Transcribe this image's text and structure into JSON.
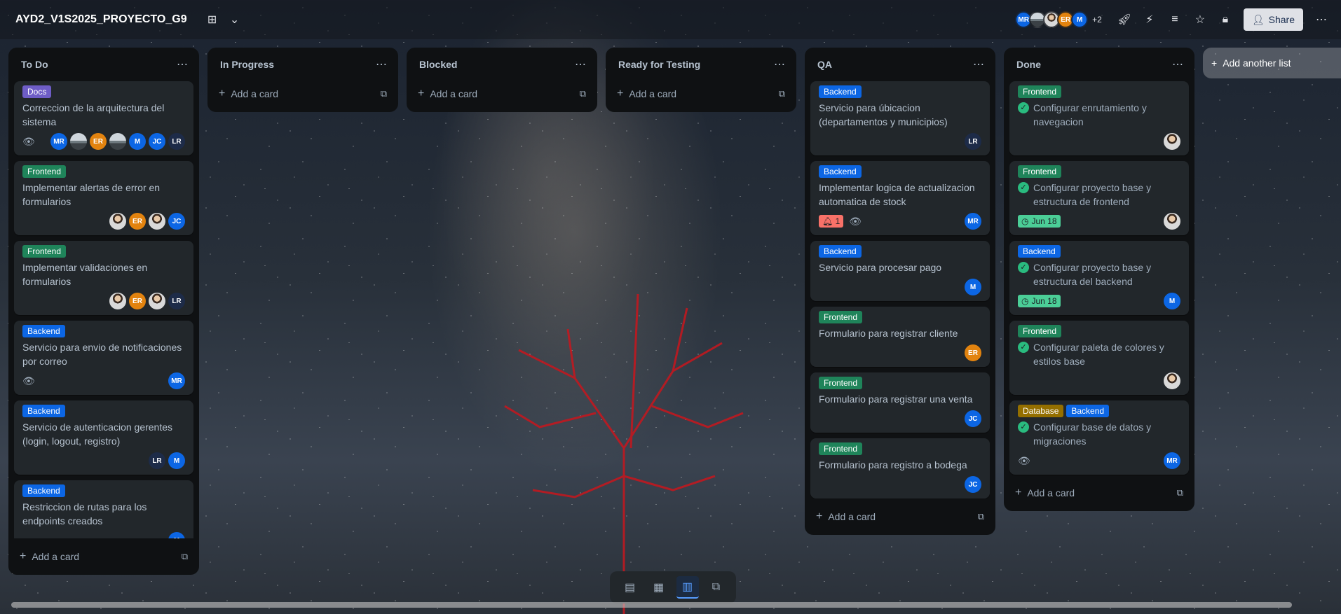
{
  "header": {
    "board_title": "AYD2_V1S2025_PROYECTO_G9",
    "members": [
      "MR",
      "",
      "",
      "ER",
      "M"
    ],
    "members_more": "+2",
    "share_label": "Share"
  },
  "lists": [
    {
      "title": "To Do",
      "cards": [
        {
          "labels": [
            "Docs"
          ],
          "title": "Correccion de la arquitectura del sistema",
          "eye": true,
          "avatars": [
            "MR",
            "",
            "ER",
            "",
            "M",
            "JC",
            "LR"
          ]
        },
        {
          "labels": [
            "Frontend"
          ],
          "title": "Implementar alertas de error en formularios",
          "avatars": [
            "",
            "ER",
            "",
            "JC"
          ]
        },
        {
          "labels": [
            "Frontend"
          ],
          "title": "Implementar validaciones en formularios",
          "avatars": [
            "",
            "ER",
            "",
            "LR"
          ]
        },
        {
          "labels": [
            "Backend"
          ],
          "title": "Servicio para envio de notificaciones por correo",
          "eye": true,
          "avatars": [
            "MR"
          ]
        },
        {
          "labels": [
            "Backend"
          ],
          "title": "Servicio de autenticacion gerentes (login, logout, registro)",
          "avatars": [
            "LR",
            "M"
          ]
        },
        {
          "labels": [
            "Backend"
          ],
          "title": "Restriccion de rutas para los endpoints creados",
          "avatars": [
            "M"
          ]
        }
      ],
      "add_label": "Add a card"
    },
    {
      "title": "In Progress",
      "cards": [],
      "add_label": "Add a card"
    },
    {
      "title": "Blocked",
      "cards": [],
      "add_label": "Add a card"
    },
    {
      "title": "Ready for Testing",
      "cards": [],
      "add_label": "Add a card"
    },
    {
      "title": "QA",
      "cards": [
        {
          "labels": [
            "Backend"
          ],
          "title": "Servicio para úbicacion (departamentos y municipios)",
          "avatars": [
            "LR"
          ]
        },
        {
          "labels": [
            "Backend"
          ],
          "title": "Implementar logica de actualizacion automatica de stock",
          "notif": "1",
          "eye": true,
          "avatars": [
            "MR"
          ]
        },
        {
          "labels": [
            "Backend"
          ],
          "title": "Servicio para procesar pago",
          "avatars": [
            "M"
          ]
        },
        {
          "labels": [
            "Frontend"
          ],
          "title": "Formulario para registrar cliente",
          "avatars": [
            "ER"
          ]
        },
        {
          "labels": [
            "Frontend"
          ],
          "title": "Formulario para registrar una venta",
          "avatars": [
            "JC"
          ]
        },
        {
          "labels": [
            "Frontend"
          ],
          "title": "Formulario para registro a bodega",
          "avatars": [
            "JC"
          ]
        }
      ],
      "add_label": "Add a card"
    },
    {
      "title": "Done",
      "cards": [
        {
          "labels": [
            "Frontend"
          ],
          "title": "Configurar enrutamiento y navegacion",
          "done": true,
          "avatars": [
            ""
          ]
        },
        {
          "labels": [
            "Frontend"
          ],
          "title": "Configurar proyecto base y estructura de frontend",
          "done": true,
          "due": "Jun 18",
          "avatars": [
            ""
          ]
        },
        {
          "labels": [
            "Backend"
          ],
          "title": "Configurar proyecto base y estructura del backend",
          "done": true,
          "due": "Jun 18",
          "avatars": [
            "M"
          ]
        },
        {
          "labels": [
            "Frontend"
          ],
          "title": "Configurar paleta de colores y estilos base",
          "done": true,
          "avatars": [
            ""
          ]
        },
        {
          "labels": [
            "Database",
            "Backend"
          ],
          "title": "Configurar base de datos y migraciones",
          "done": true,
          "eye": true,
          "avatars": [
            "MR"
          ]
        }
      ],
      "add_label": "Add a card"
    }
  ],
  "add_list_label": "Add another list",
  "avatar_colors": {
    "MR": "#0c66e4",
    "M": "#0c66e4",
    "JC": "#0c66e4",
    "ER": "#e2830f",
    "LR": "#1d2b48"
  }
}
